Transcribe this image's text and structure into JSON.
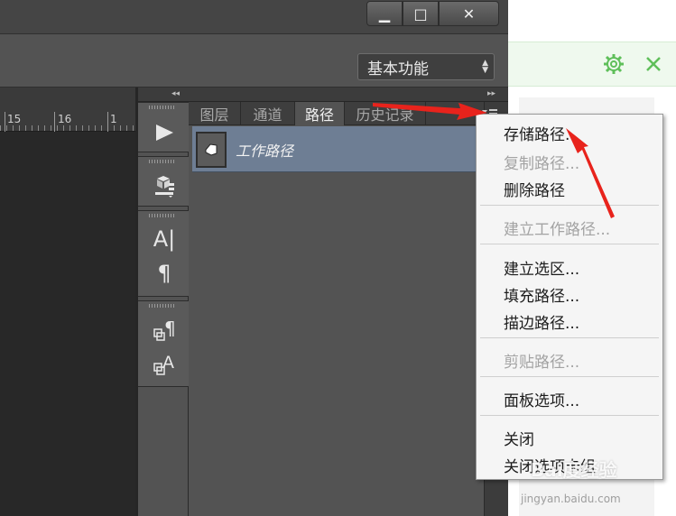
{
  "window": {
    "minimize_symbol": "▁",
    "maximize_symbol": "□",
    "close_symbol": "✕"
  },
  "options_bar": {
    "workspace_label": "基本功能"
  },
  "ruler": {
    "labels": [
      "15",
      "16",
      "1"
    ]
  },
  "paths_panel": {
    "tabs": [
      "图层",
      "通道",
      "路径",
      "历史记录"
    ],
    "active_tab": "路径",
    "path_name": "工作路径"
  },
  "tool_icons": [
    "play-icon",
    "cube-icon",
    "character-icon",
    "paragraph-icon",
    "paragraph-style-icon",
    "character-style-icon"
  ],
  "context_menu": {
    "items": [
      {
        "label": "存储路径...",
        "enabled": true
      },
      {
        "label": "复制路径...",
        "enabled": false
      },
      {
        "label": "删除路径",
        "enabled": true
      },
      {
        "label": "建立工作路径...",
        "enabled": false
      },
      {
        "label": "建立选区...",
        "enabled": true
      },
      {
        "label": "填充路径...",
        "enabled": true
      },
      {
        "label": "描边路径...",
        "enabled": true
      },
      {
        "label": "剪贴路径...",
        "enabled": false
      },
      {
        "label": "面板选项...",
        "enabled": true
      },
      {
        "label": "关闭",
        "enabled": true
      },
      {
        "label": "关闭选项卡组",
        "enabled": true
      }
    ]
  },
  "watermark": {
    "brand": "Bai度经验",
    "url": "jingyan.baidu.com"
  },
  "colors": {
    "annotation_arrow": "#e8231c",
    "selected_path_row": "#6e7e94",
    "browser_bar": "#eff9ee",
    "browser_icon": "#5fbf5a"
  }
}
